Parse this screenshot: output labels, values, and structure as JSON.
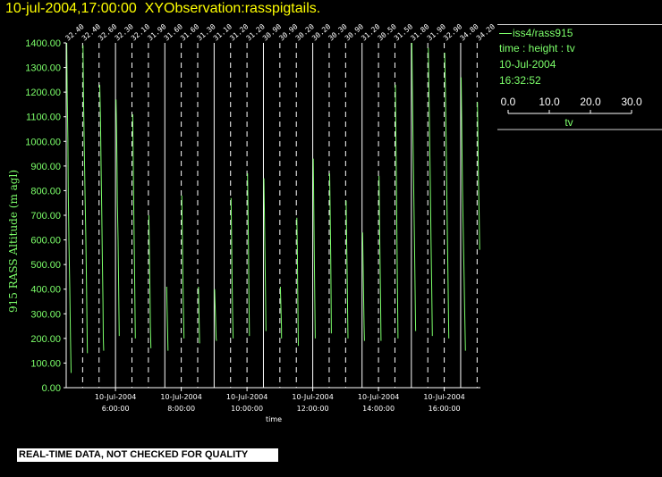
{
  "header": {
    "title": "10-jul-2004,17:00:00  XYObservation:rasspigtails."
  },
  "legend": {
    "series_label": "iss4/rass915",
    "description": "time : height : tv",
    "date": "10-Jul-2004",
    "time": "16:32:52",
    "scale_ticks": [
      "0.0",
      "10.0",
      "20.0",
      "30.0"
    ],
    "scale_label": "tv"
  },
  "footer": {
    "note": "REAL-TIME DATA, NOT CHECKED FOR QUALITY"
  },
  "colors": {
    "background": "#000000",
    "line": "#7cff6a",
    "title": "#ffff00",
    "axis": "#ffffff"
  },
  "chart_data": {
    "type": "line",
    "title": "",
    "ylabel": "915 RASS Altitude (m agl)",
    "xlabel": "time",
    "ylim": [
      0,
      1400
    ],
    "yticks": [
      "0.00",
      "100.00",
      "200.00",
      "300.00",
      "400.00",
      "500.00",
      "600.00",
      "700.00",
      "800.00",
      "900.00",
      "1000.00",
      "1100.00",
      "1200.00",
      "1300.00",
      "1400.00"
    ],
    "xlim": [
      4.5,
      17.1
    ],
    "xticks": [
      {
        "t": 6,
        "date": "10-Jul-2004",
        "time": "6:00:00"
      },
      {
        "t": 8,
        "date": "10-Jul-2004",
        "time": "8:00:00"
      },
      {
        "t": 10,
        "date": "10-Jul-2004",
        "time": "10:00:00"
      },
      {
        "t": 12,
        "date": "10-Jul-2004",
        "time": "12:00:00"
      },
      {
        "t": 14,
        "date": "10-Jul-2004",
        "time": "14:00:00"
      },
      {
        "t": 16,
        "date": "10-Jul-2004",
        "time": "16:00:00"
      }
    ],
    "profile_scale": "tv 0.0 - 30.0",
    "profiles": [
      {
        "t": 4.5,
        "label": "32.40",
        "points": [
          [
            0.3,
            1400
          ],
          [
            0.6,
            1200
          ],
          [
            1.0,
            1000
          ],
          [
            1.2,
            800
          ],
          [
            1.6,
            600
          ],
          [
            2.1,
            400
          ],
          [
            2.5,
            200
          ],
          [
            2.9,
            60
          ]
        ]
      },
      {
        "t": 5.0,
        "label": "32.40",
        "points": [
          [
            0.2,
            1390
          ],
          [
            0.5,
            1200
          ],
          [
            0.9,
            1000
          ],
          [
            1.4,
            800
          ],
          [
            1.9,
            600
          ],
          [
            2.3,
            420
          ],
          [
            2.6,
            250
          ],
          [
            2.8,
            140
          ]
        ]
      },
      {
        "t": 5.5,
        "label": "32.60",
        "points": [
          [
            0.4,
            1230
          ],
          [
            0.8,
            1100
          ],
          [
            1.2,
            900
          ],
          [
            1.6,
            700
          ],
          [
            2.0,
            500
          ],
          [
            2.3,
            350
          ],
          [
            2.5,
            200
          ],
          [
            2.7,
            150
          ]
        ]
      },
      {
        "t": 6.0,
        "label": "32.30",
        "points": [
          [
            0.3,
            1170
          ],
          [
            0.6,
            1050
          ],
          [
            0.9,
            900
          ],
          [
            1.1,
            750
          ],
          [
            1.5,
            600
          ],
          [
            1.8,
            450
          ],
          [
            2.0,
            320
          ],
          [
            2.2,
            210
          ]
        ]
      },
      {
        "t": 6.5,
        "label": "32.10",
        "points": [
          [
            0.4,
            1110
          ],
          [
            0.8,
            900
          ],
          [
            1.1,
            700
          ],
          [
            1.4,
            540
          ],
          [
            1.7,
            380
          ],
          [
            2.0,
            200
          ]
        ]
      },
      {
        "t": 7.0,
        "label": "31.90",
        "points": [
          [
            0.3,
            700
          ],
          [
            0.6,
            550
          ],
          [
            0.9,
            400
          ],
          [
            1.2,
            250
          ],
          [
            1.5,
            160
          ]
        ]
      },
      {
        "t": 7.5,
        "label": "31.60",
        "points": [
          [
            1.1,
            410
          ],
          [
            1.3,
            330
          ],
          [
            1.6,
            240
          ],
          [
            1.9,
            150
          ]
        ]
      },
      {
        "t": 8.0,
        "label": "31.60",
        "points": [
          [
            0.3,
            780
          ],
          [
            0.6,
            620
          ],
          [
            0.9,
            480
          ],
          [
            1.2,
            340
          ],
          [
            1.6,
            200
          ]
        ]
      },
      {
        "t": 8.5,
        "label": "31.30",
        "points": [
          [
            0.5,
            410
          ],
          [
            0.7,
            330
          ],
          [
            0.9,
            250
          ],
          [
            1.1,
            180
          ]
        ]
      },
      {
        "t": 9.0,
        "label": "31.10",
        "points": [
          [
            0.3,
            400
          ],
          [
            0.6,
            330
          ],
          [
            0.9,
            260
          ],
          [
            1.2,
            200
          ],
          [
            1.4,
            190
          ]
        ]
      },
      {
        "t": 9.5,
        "label": "31.20",
        "points": [
          [
            0.3,
            770
          ],
          [
            0.6,
            600
          ],
          [
            0.9,
            450
          ],
          [
            1.2,
            300
          ],
          [
            1.5,
            200
          ]
        ]
      },
      {
        "t": 10.0,
        "label": "31.20",
        "points": [
          [
            0.3,
            870
          ],
          [
            0.6,
            720
          ],
          [
            0.9,
            560
          ],
          [
            1.1,
            400
          ],
          [
            1.4,
            210
          ]
        ]
      },
      {
        "t": 10.5,
        "label": "30.90",
        "points": [
          [
            0.3,
            850
          ],
          [
            0.6,
            700
          ],
          [
            0.9,
            540
          ],
          [
            1.2,
            380
          ],
          [
            1.5,
            230
          ]
        ]
      },
      {
        "t": 11.0,
        "label": "30.90",
        "points": [
          [
            0.3,
            410
          ],
          [
            0.6,
            330
          ],
          [
            0.9,
            250
          ],
          [
            1.0,
            200
          ]
        ]
      },
      {
        "t": 11.5,
        "label": "30.20",
        "points": [
          [
            0.3,
            690
          ],
          [
            0.6,
            560
          ],
          [
            0.8,
            420
          ],
          [
            1.0,
            300
          ],
          [
            1.2,
            170
          ]
        ]
      },
      {
        "t": 12.0,
        "label": "30.20",
        "points": [
          [
            0.3,
            930
          ],
          [
            0.6,
            750
          ],
          [
            0.9,
            550
          ],
          [
            1.2,
            350
          ],
          [
            1.5,
            200
          ]
        ]
      },
      {
        "t": 12.5,
        "label": "30.30",
        "points": [
          [
            0.3,
            870
          ],
          [
            0.6,
            700
          ],
          [
            0.9,
            530
          ],
          [
            1.1,
            370
          ],
          [
            1.3,
            220
          ]
        ]
      },
      {
        "t": 13.0,
        "label": "30.90",
        "points": [
          [
            0.3,
            760
          ],
          [
            0.6,
            600
          ],
          [
            0.9,
            450
          ],
          [
            1.2,
            300
          ],
          [
            1.4,
            200
          ]
        ]
      },
      {
        "t": 13.5,
        "label": "31.20",
        "points": [
          [
            0.3,
            630
          ],
          [
            0.6,
            500
          ],
          [
            0.9,
            380
          ],
          [
            1.2,
            250
          ],
          [
            1.4,
            190
          ]
        ]
      },
      {
        "t": 14.0,
        "label": "30.50",
        "points": [
          [
            0.3,
            860
          ],
          [
            0.6,
            690
          ],
          [
            0.9,
            520
          ],
          [
            1.2,
            360
          ],
          [
            1.5,
            190
          ]
        ]
      },
      {
        "t": 14.5,
        "label": "31.50",
        "points": [
          [
            0.3,
            1230
          ],
          [
            0.6,
            1000
          ],
          [
            0.9,
            800
          ],
          [
            1.2,
            600
          ],
          [
            1.5,
            400
          ],
          [
            1.8,
            200
          ]
        ]
      },
      {
        "t": 15.0,
        "label": "31.80",
        "points": [
          [
            0.3,
            1400
          ],
          [
            0.6,
            1200
          ],
          [
            1.0,
            1000
          ],
          [
            1.4,
            800
          ],
          [
            1.8,
            600
          ],
          [
            2.2,
            400
          ],
          [
            2.5,
            230
          ]
        ]
      },
      {
        "t": 15.5,
        "label": "31.90",
        "points": [
          [
            0.3,
            1380
          ],
          [
            0.7,
            1200
          ],
          [
            1.1,
            1000
          ],
          [
            1.5,
            800
          ],
          [
            1.9,
            600
          ],
          [
            2.3,
            400
          ],
          [
            2.7,
            210
          ]
        ]
      },
      {
        "t": 16.0,
        "label": "32.90",
        "points": [
          [
            0.3,
            1360
          ],
          [
            0.7,
            1200
          ],
          [
            1.1,
            1000
          ],
          [
            1.5,
            800
          ],
          [
            1.9,
            600
          ],
          [
            2.3,
            420
          ],
          [
            2.7,
            200
          ]
        ]
      },
      {
        "t": 16.5,
        "label": "34.80",
        "points": [
          [
            0.3,
            1260
          ],
          [
            0.7,
            1000
          ],
          [
            1.1,
            800
          ],
          [
            1.6,
            600
          ],
          [
            2.0,
            450
          ],
          [
            2.4,
            300
          ],
          [
            2.8,
            150
          ]
        ]
      },
      {
        "t": 17.0,
        "label": "34.20",
        "points": [
          [
            0.2,
            1160
          ],
          [
            0.5,
            1000
          ],
          [
            0.8,
            850
          ],
          [
            1.2,
            700
          ],
          [
            1.5,
            560
          ]
        ]
      }
    ]
  }
}
